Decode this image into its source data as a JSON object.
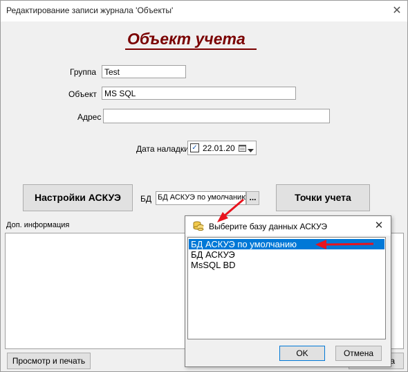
{
  "window": {
    "title": "Редактирование записи журнала 'Объекты'",
    "close_glyph": "✕"
  },
  "form": {
    "heading": "Объект учета",
    "group": {
      "label": "Группа",
      "value": "Test"
    },
    "object": {
      "label": "Объект",
      "value": "MS SQL"
    },
    "address": {
      "label": "Адрес",
      "value": ""
    },
    "setup_date": {
      "label": "Дата наладки",
      "checked": true,
      "check_glyph": "✓",
      "value": "22.01.20"
    },
    "askue_settings_button": "Настройки АСКУЭ",
    "db": {
      "label": "БД",
      "value": "БД АСКУЭ по умолчанию",
      "browse_label": "..."
    },
    "meter_points_button": "Точки учета",
    "extra_info_label": "Доп. информация",
    "preview_print_button": "Просмотр и печать",
    "hidden_button_fragment": "а"
  },
  "dialog": {
    "title": "Выберите базу данных АСКУЭ",
    "close_glyph": "✕",
    "items": [
      "БД АСКУЭ по умолчанию",
      "БД АСКУЭ",
      "MsSQL BD"
    ],
    "selected_index": 0,
    "ok_label": "OK",
    "cancel_label": "Отмена"
  },
  "colors": {
    "heading": "#7a0000",
    "selection": "#0078d7",
    "annotation_arrow": "#e8141e"
  }
}
